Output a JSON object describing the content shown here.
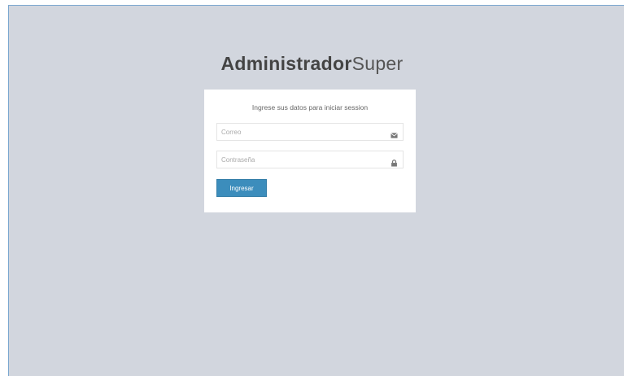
{
  "brand": {
    "bold": "Administrador",
    "light": "Super"
  },
  "login": {
    "message": "Ingrese sus datos para iniciar session",
    "email": {
      "placeholder": "Correo",
      "value": "",
      "icon": "envelope-icon"
    },
    "password": {
      "placeholder": "Contraseña",
      "value": "",
      "icon": "lock-icon"
    },
    "submit_label": "Ingresar"
  },
  "colors": {
    "background": "#d2d6de",
    "accent": "#3c8dbc",
    "box": "#ffffff"
  }
}
